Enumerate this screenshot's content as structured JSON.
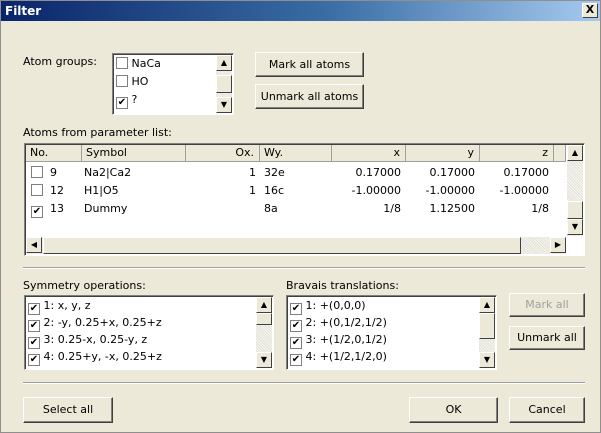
{
  "window": {
    "title": "Filter",
    "close_glyph": "X"
  },
  "atom_groups": {
    "label": "Atom groups:",
    "items": [
      {
        "label": "NaCa",
        "checked": false
      },
      {
        "label": "HO",
        "checked": false
      },
      {
        "label": "?",
        "checked": true
      }
    ]
  },
  "buttons": {
    "mark_all_atoms": "Mark all atoms",
    "unmark_all_atoms": "Unmark all atoms",
    "mark_all": "Mark all",
    "unmark_all": "Unmark all",
    "select_all": "Select all",
    "ok": "OK",
    "cancel": "Cancel"
  },
  "atoms": {
    "label": "Atoms from parameter list:",
    "columns": [
      "No.",
      "Symbol",
      "Ox.",
      "Wy.",
      "x",
      "y",
      "z"
    ],
    "rows": [
      {
        "checked": false,
        "no": "9",
        "symbol": "Na2|Ca2",
        "ox": "1",
        "wy": "32e",
        "x": "0.17000",
        "y": "0.17000",
        "z": "0.17000"
      },
      {
        "checked": false,
        "no": "12",
        "symbol": "H1|O5",
        "ox": "1",
        "wy": "16c",
        "x": "-1.00000",
        "y": "-1.00000",
        "z": "-1.00000"
      },
      {
        "checked": true,
        "no": "13",
        "symbol": "Dummy",
        "ox": "",
        "wy": "8a",
        "x": "1/8",
        "y": "1.12500",
        "z": "1/8"
      }
    ]
  },
  "symmetry": {
    "label": "Symmetry operations:",
    "items": [
      {
        "label": "1: x, y, z",
        "checked": true
      },
      {
        "label": "2: -y, 0.25+x, 0.25+z",
        "checked": true
      },
      {
        "label": "3: 0.25-x, 0.25-y, z",
        "checked": true
      },
      {
        "label": "4: 0.25+y, -x, 0.25+z",
        "checked": true
      }
    ]
  },
  "bravais": {
    "label": "Bravais translations:",
    "items": [
      {
        "label": "1: +(0,0,0)",
        "checked": true
      },
      {
        "label": "2: +(0,1/2,1/2)",
        "checked": true
      },
      {
        "label": "3: +(1/2,0,1/2)",
        "checked": true
      },
      {
        "label": "4: +(1/2,1/2,0)",
        "checked": true
      }
    ]
  },
  "icons": {
    "check": "✔",
    "scroll_up": "▲",
    "scroll_down": "▼",
    "scroll_left": "◀",
    "scroll_right": "▶"
  }
}
